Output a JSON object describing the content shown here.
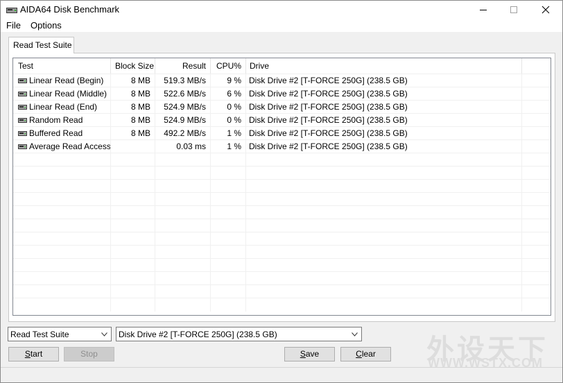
{
  "window": {
    "title": "AIDA64 Disk Benchmark"
  },
  "menu": [
    "File",
    "Options"
  ],
  "tabs": [
    {
      "label": "Read Test Suite"
    }
  ],
  "table": {
    "columns": [
      "Test",
      "Block Size",
      "Result",
      "CPU%",
      "Drive"
    ],
    "rows": [
      {
        "test": "Linear Read (Begin)",
        "block": "8 MB",
        "result": "519.3 MB/s",
        "cpu": "9 %",
        "drive": "Disk Drive #2  [T-FORCE 250G]  (238.5 GB)"
      },
      {
        "test": "Linear Read (Middle)",
        "block": "8 MB",
        "result": "522.6 MB/s",
        "cpu": "6 %",
        "drive": "Disk Drive #2  [T-FORCE 250G]  (238.5 GB)"
      },
      {
        "test": "Linear Read (End)",
        "block": "8 MB",
        "result": "524.9 MB/s",
        "cpu": "0 %",
        "drive": "Disk Drive #2  [T-FORCE 250G]  (238.5 GB)"
      },
      {
        "test": "Random Read",
        "block": "8 MB",
        "result": "524.9 MB/s",
        "cpu": "0 %",
        "drive": "Disk Drive #2  [T-FORCE 250G]  (238.5 GB)"
      },
      {
        "test": "Buffered Read",
        "block": "8 MB",
        "result": "492.2 MB/s",
        "cpu": "1 %",
        "drive": "Disk Drive #2  [T-FORCE 250G]  (238.5 GB)"
      },
      {
        "test": "Average Read Access",
        "block": "",
        "result": "0.03 ms",
        "cpu": "1 %",
        "drive": "Disk Drive #2  [T-FORCE 250G]  (238.5 GB)"
      }
    ]
  },
  "controls": {
    "suite_select": "Read Test Suite",
    "drive_select": "Disk Drive #2  [T-FORCE 250G]  (238.5 GB)",
    "start": {
      "mnemonic": "S",
      "rest": "tart"
    },
    "stop": "Stop",
    "save": {
      "mnemonic": "S",
      "rest": "ave"
    },
    "clear": {
      "mnemonic": "C",
      "rest": "lear"
    }
  },
  "watermark": {
    "cn": "外设天下",
    "en": "WWW.WSTX.COM"
  },
  "colors": {
    "window_bg": "#f0f0f0",
    "list_bg": "#ffffff",
    "border": "#828790"
  },
  "icons": {
    "app": "disk-drive-icon",
    "row": "disk-drive-icon"
  }
}
